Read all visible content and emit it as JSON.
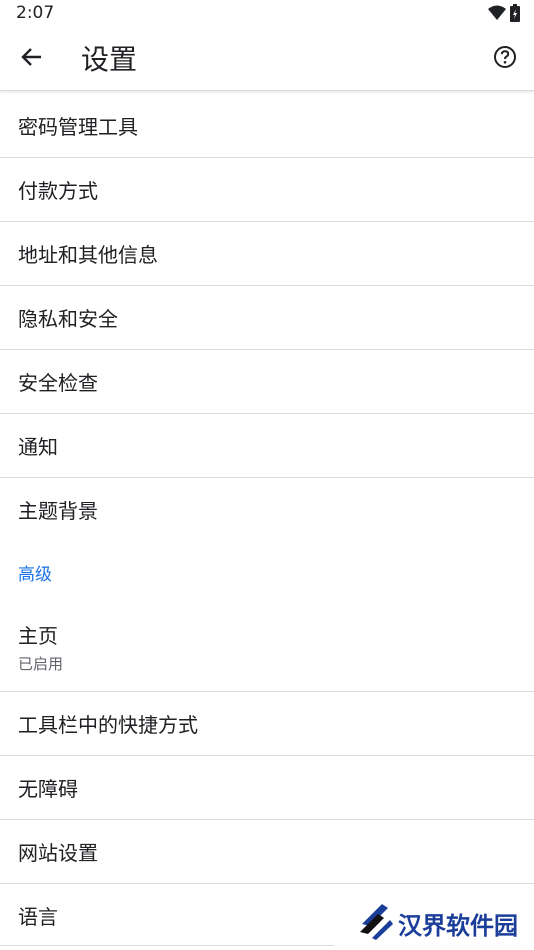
{
  "status_bar": {
    "time": "2:07"
  },
  "app_bar": {
    "title": "设置"
  },
  "items": [
    {
      "label": "密码管理工具"
    },
    {
      "label": "付款方式"
    },
    {
      "label": "地址和其他信息"
    },
    {
      "label": "隐私和安全"
    },
    {
      "label": "安全检查"
    },
    {
      "label": "通知"
    },
    {
      "label": "主题背景"
    }
  ],
  "advanced_header": "高级",
  "advanced_items": [
    {
      "label": "主页",
      "sublabel": "已启用"
    },
    {
      "label": "工具栏中的快捷方式"
    },
    {
      "label": "无障碍"
    },
    {
      "label": "网站设置"
    },
    {
      "label": "语言"
    }
  ],
  "watermark": {
    "text": "汉界软件园"
  },
  "colors": {
    "accent": "#1a73e8",
    "divider": "#dadce0",
    "text": "#202124",
    "secondary": "#5f6368"
  }
}
